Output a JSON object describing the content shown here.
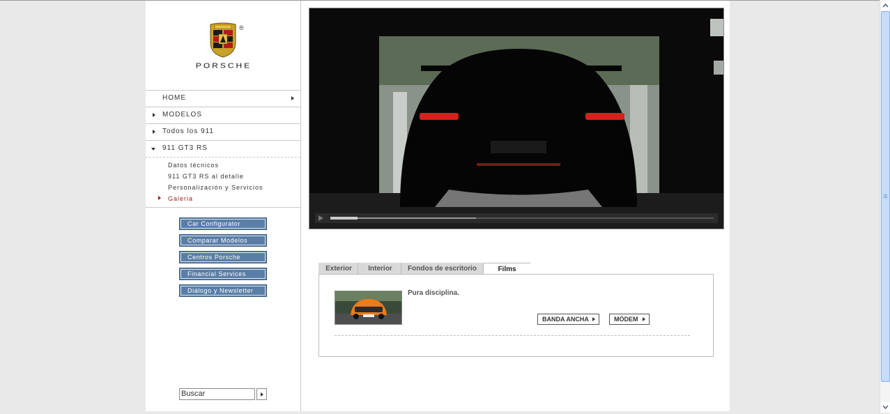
{
  "brand": {
    "name": "PORSCHE",
    "registered": "®"
  },
  "nav": {
    "items": [
      {
        "label": "HOME"
      },
      {
        "label": "MODELOS"
      },
      {
        "label": "Todos los 911"
      },
      {
        "label": "911 GT3 RS"
      }
    ],
    "sub_items": [
      {
        "label": "Datos técnicos"
      },
      {
        "label": "911 GT3 RS al detalle"
      },
      {
        "label": "Personalización y Servicios"
      },
      {
        "label": "Galeria",
        "active": true
      }
    ]
  },
  "quick_buttons": [
    {
      "label": "Car Configurator"
    },
    {
      "label": "Comparar Modelos"
    },
    {
      "label": "Centros Porsche"
    },
    {
      "label": "Financial Services"
    },
    {
      "label": "Diálogo y Newsletter"
    }
  ],
  "search": {
    "placeholder": "Buscar"
  },
  "video": {
    "progress_played": 0.07,
    "progress_buffered": 0.38
  },
  "gallery": {
    "tabs": [
      {
        "label": "Exterior"
      },
      {
        "label": "Interior"
      },
      {
        "label": "Fondos de escritorio"
      },
      {
        "label": "Films",
        "active": true
      }
    ],
    "film": {
      "title": "Pura disciplina.",
      "btn_broadband": "BANDA ANCHA",
      "btn_modem": "MÓDEM"
    }
  },
  "colors": {
    "accent_red": "#9b1a1a",
    "button_blue": "#5a7ea6"
  }
}
